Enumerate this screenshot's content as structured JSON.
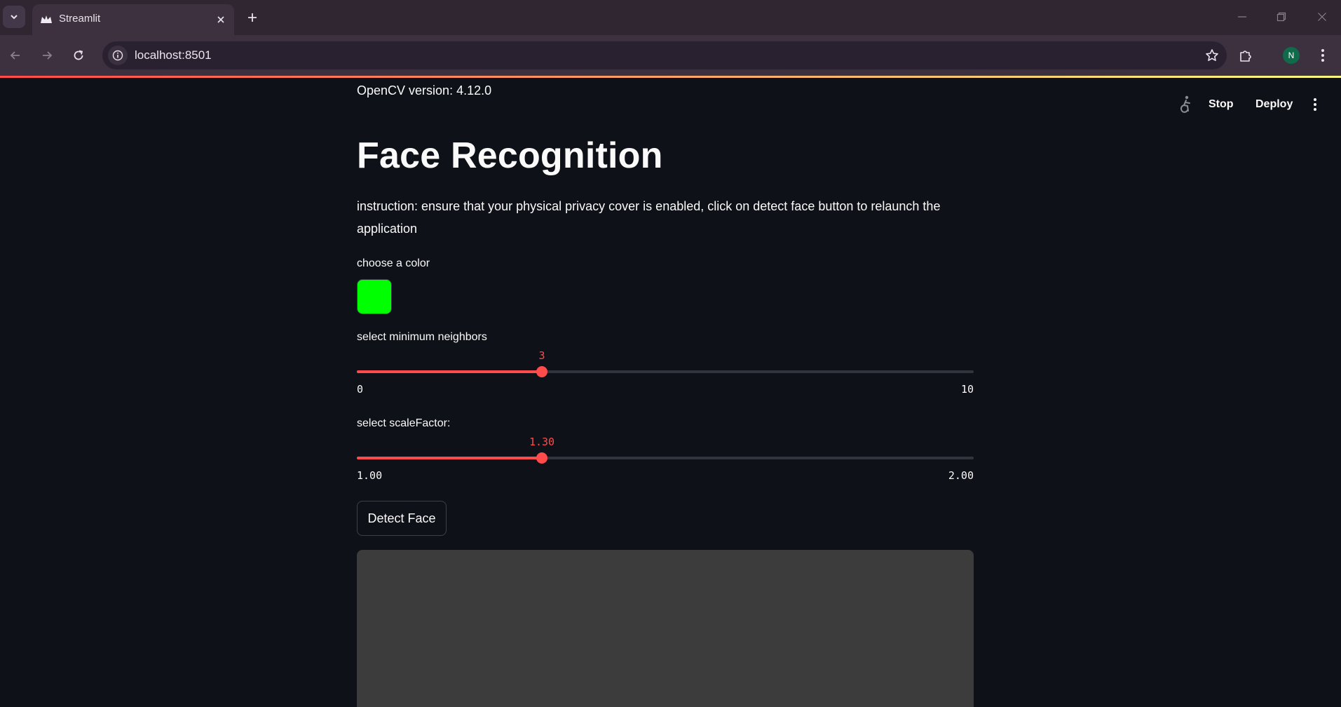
{
  "browser": {
    "tab_title": "Streamlit",
    "url": "localhost:8501",
    "profile_initial": "N"
  },
  "header": {
    "stop_label": "Stop",
    "deploy_label": "Deploy"
  },
  "main": {
    "version_text": "OpenCV version: 4.12.0",
    "title": "Face Recognition",
    "instruction": "instruction: ensure that your physical privacy cover is enabled, click on detect face button to relaunch the application",
    "color_picker": {
      "label": "choose a color",
      "value": "#00ff00"
    },
    "neighbors_slider": {
      "label": "select minimum neighbors",
      "value": "3",
      "min": "0",
      "max": "10",
      "fraction": 0.3
    },
    "scale_slider": {
      "label": "select scaleFactor:",
      "value": "1.30",
      "min": "1.00",
      "max": "2.00",
      "fraction": 0.3
    },
    "detect_button_label": "Detect Face"
  },
  "colors": {
    "accent": "#ff4b4b",
    "background": "#0e1117",
    "video_placeholder": "#3c3c3c"
  },
  "icons": [
    "chevron-down-icon",
    "streamlit-crown-icon",
    "close-icon",
    "plus-icon",
    "minimize-icon",
    "restore-icon",
    "back-arrow-icon",
    "forward-arrow-icon",
    "reload-icon",
    "info-icon",
    "star-icon",
    "puzzle-icon",
    "kebab-menu-icon",
    "running-man-icon"
  ]
}
